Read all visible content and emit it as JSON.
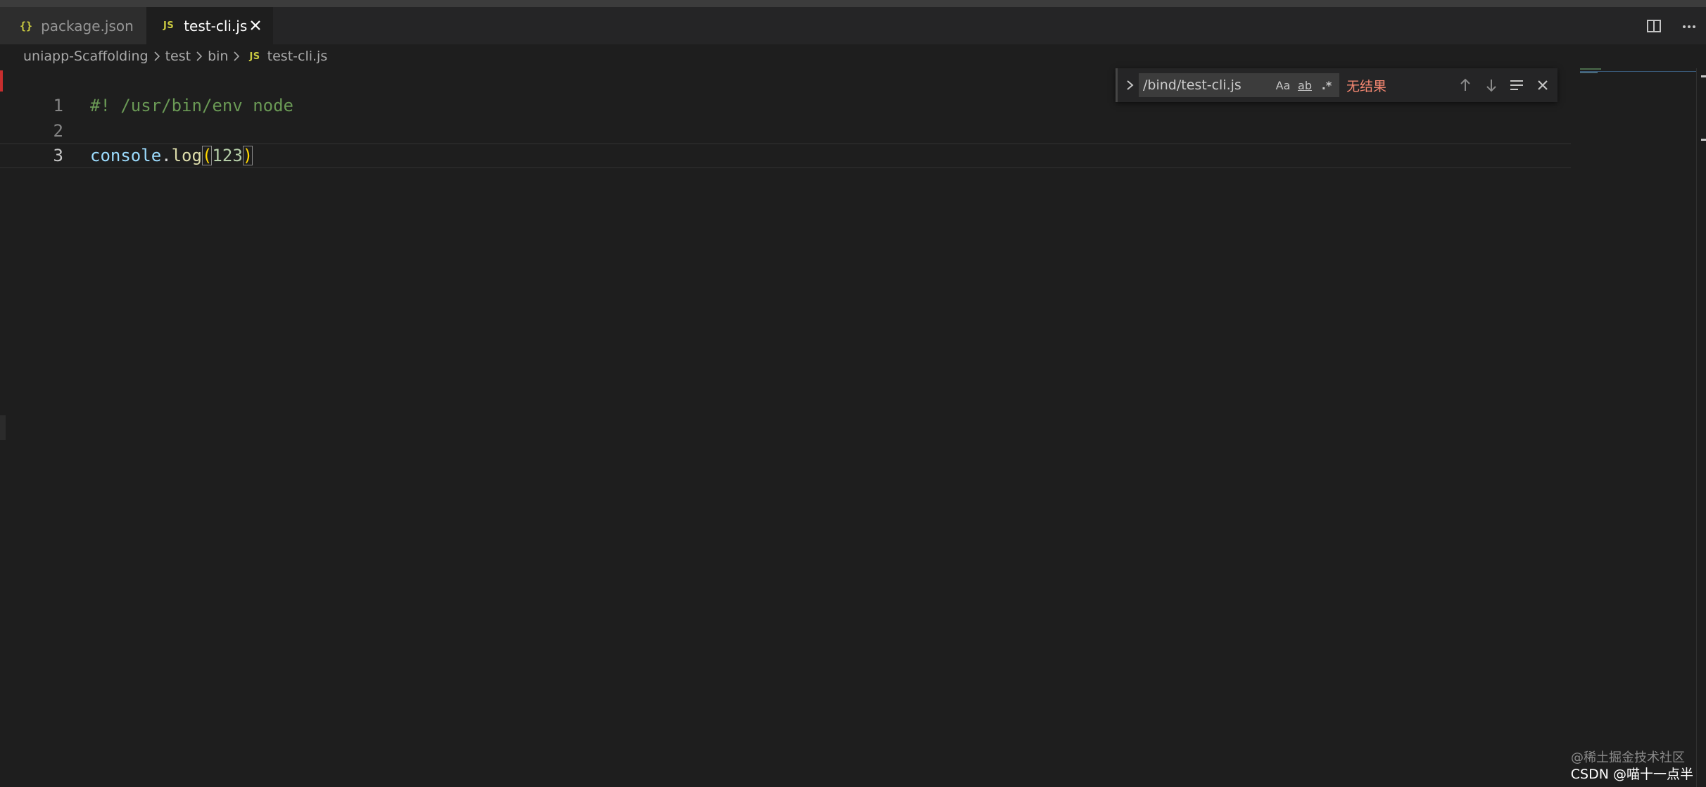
{
  "tabs": [
    {
      "label": "package.json",
      "icon": "json-icon",
      "icon_glyph": "{}"
    },
    {
      "label": "test-cli.js",
      "icon": "js-icon",
      "icon_glyph": "JS",
      "active": true
    }
  ],
  "breadcrumb": {
    "items": [
      "uniapp-Scaffolding",
      "test",
      "bin"
    ],
    "file_icon": "JS",
    "file": "test-cli.js"
  },
  "editor": {
    "lines": [
      {
        "number": "1",
        "tokens": {
          "comment": "#! /usr/bin/env node"
        }
      },
      {
        "number": "2",
        "tokens": {}
      },
      {
        "number": "3",
        "tokens": {
          "obj": "console",
          "dot": ".",
          "fn": "log",
          "open": "(",
          "arg": "123",
          "close": ")"
        }
      }
    ]
  },
  "find": {
    "value": "/bind/test-cli.js",
    "match_case": "Aa",
    "whole_word": "ab",
    "regex": ".*",
    "result": "无结果"
  },
  "watermark": {
    "line1": "@稀土掘金技术社区",
    "line2": "CSDN @喵十一点半"
  },
  "colors": {
    "accent_yellow": "#cbcb41",
    "no_result": "#f48771",
    "comment": "#6a9955"
  }
}
